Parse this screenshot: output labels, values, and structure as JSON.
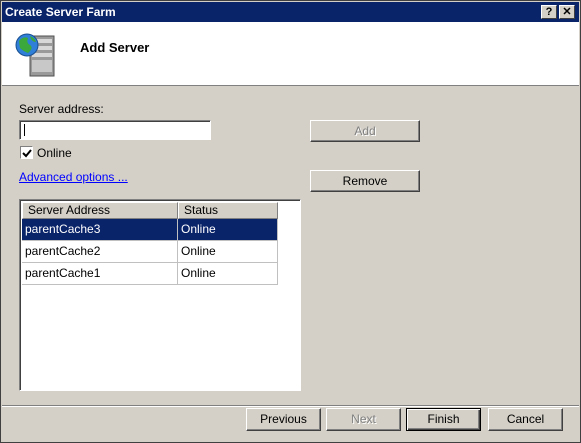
{
  "window": {
    "title": "Create Server Farm",
    "help_label": "?",
    "close_label": "✕"
  },
  "header": {
    "title": "Add Server",
    "icon": "server-globe-icon"
  },
  "form": {
    "server_address_label": "Server address:",
    "server_address_value": "",
    "online_label": "Online",
    "online_checked": true,
    "advanced_link": "Advanced options ..."
  },
  "buttons": {
    "add": "Add",
    "remove": "Remove",
    "previous": "Previous",
    "next": "Next",
    "finish": "Finish",
    "cancel": "Cancel"
  },
  "table": {
    "columns": [
      "Server Address",
      "Status"
    ],
    "rows": [
      {
        "address": "parentCache3",
        "status": "Online",
        "selected": true
      },
      {
        "address": "parentCache2",
        "status": "Online",
        "selected": false
      },
      {
        "address": "parentCache1",
        "status": "Online",
        "selected": false
      }
    ]
  },
  "colors": {
    "title_bar": "#0a246a",
    "selection": "#0a246a",
    "link": "#0000ff"
  }
}
